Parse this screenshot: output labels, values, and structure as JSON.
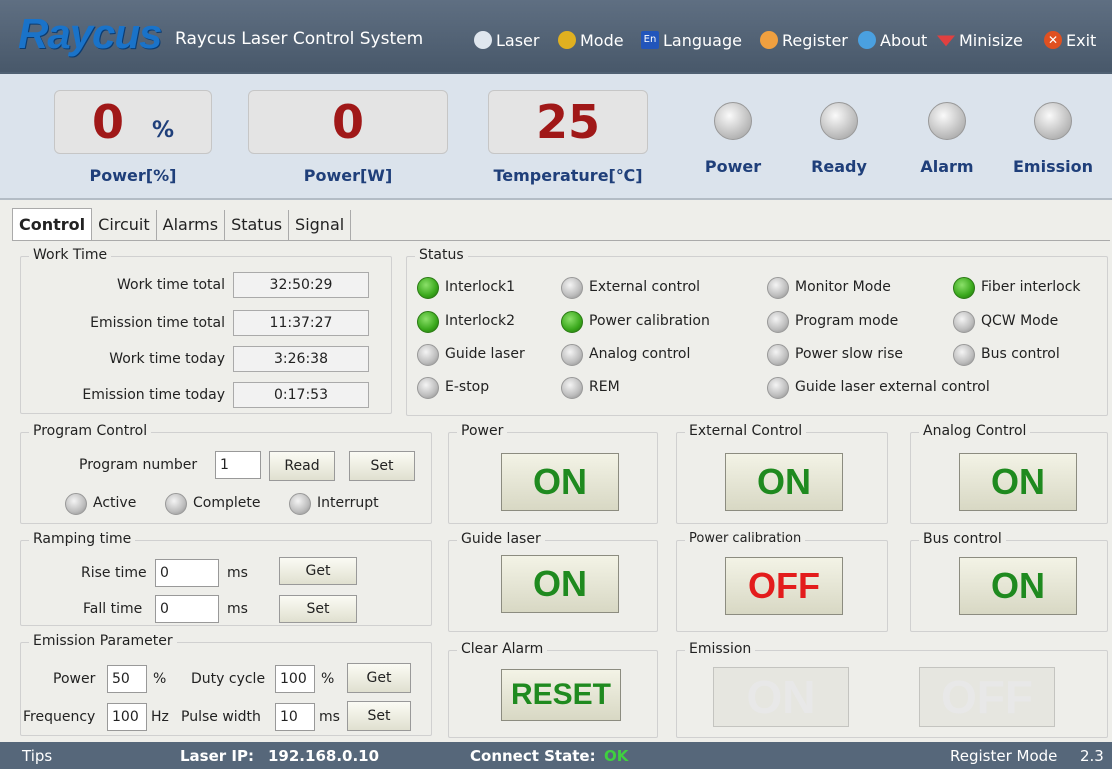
{
  "titlebar": {
    "logo": "Raycus",
    "title": "Raycus Laser Control System",
    "menu": [
      {
        "label": "Laser",
        "icon": "laser-icon",
        "color": "#ffffff"
      },
      {
        "label": "Mode",
        "icon": "people-icon",
        "color": "#e0b020"
      },
      {
        "label": "Language",
        "icon": "en-icon",
        "color": "#2255bb"
      },
      {
        "label": "Register",
        "icon": "pen-icon",
        "color": "#f0a040"
      },
      {
        "label": "About",
        "icon": "globe-icon",
        "color": "#4aa0e0"
      },
      {
        "label": "Minisize",
        "icon": "minimize-icon",
        "color": "#e04040"
      },
      {
        "label": "Exit",
        "icon": "close-icon",
        "color": "#e05020"
      }
    ]
  },
  "readouts": {
    "power_pct": "0",
    "power_pct_unit": "%",
    "power_pct_label": "Power[%]",
    "power_w": "0",
    "power_w_label": "Power[W]",
    "temp": "25",
    "temp_label": "Temperature[℃]"
  },
  "indicators": [
    "Power",
    "Ready",
    "Alarm",
    "Emission"
  ],
  "tabs": [
    "Control",
    "Circuit",
    "Alarms",
    "Status",
    "Signal"
  ],
  "work_time": {
    "title": "Work Time",
    "rows": [
      {
        "label": "Work time total",
        "value": "32:50:29"
      },
      {
        "label": "Emission time total",
        "value": "11:37:27"
      },
      {
        "label": "Work time today",
        "value": "3:26:38"
      },
      {
        "label": "Emission time today",
        "value": "0:17:53"
      }
    ]
  },
  "status": {
    "title": "Status",
    "items": [
      {
        "label": "Interlock1",
        "on": true
      },
      {
        "label": "External control",
        "on": false
      },
      {
        "label": "Monitor Mode",
        "on": false
      },
      {
        "label": "Fiber interlock",
        "on": true
      },
      {
        "label": "Interlock2",
        "on": true
      },
      {
        "label": "Power calibration",
        "on": true
      },
      {
        "label": "Program mode",
        "on": false
      },
      {
        "label": "QCW Mode",
        "on": false
      },
      {
        "label": "Guide laser",
        "on": false
      },
      {
        "label": "Analog control",
        "on": false
      },
      {
        "label": "Power slow rise",
        "on": false
      },
      {
        "label": "Bus control",
        "on": false
      },
      {
        "label": "E-stop",
        "on": false
      },
      {
        "label": "REM",
        "on": false
      },
      {
        "label": "Guide laser external control",
        "on": false
      }
    ]
  },
  "program": {
    "title": "Program Control",
    "number_label": "Program number",
    "number": "1",
    "read": "Read",
    "set": "Set",
    "active": "Active",
    "complete": "Complete",
    "interrupt": "Interrupt"
  },
  "ramping": {
    "title": "Ramping time",
    "rise_label": "Rise time",
    "rise": "0",
    "fall_label": "Fall time",
    "fall": "0",
    "unit": "ms",
    "get": "Get",
    "set": "Set"
  },
  "emission_param": {
    "title": "Emission Parameter",
    "power_label": "Power",
    "power": "50",
    "pct": "%",
    "duty_label": "Duty cycle",
    "duty": "100",
    "duty_unit": "%",
    "get": "Get",
    "freq_label": "Frequency",
    "freq": "100",
    "hz": "Hz",
    "pulse_label": "Pulse width",
    "pulse": "10",
    "ms": "ms",
    "set": "Set"
  },
  "switches": {
    "power": {
      "title": "Power",
      "state": "ON"
    },
    "external": {
      "title": "External Control",
      "state": "ON"
    },
    "analog": {
      "title": "Analog Control",
      "state": "ON"
    },
    "guide": {
      "title": "Guide laser",
      "state": "ON"
    },
    "calib": {
      "title": "Power  calibration",
      "state": "OFF"
    },
    "bus": {
      "title": "Bus control",
      "state": "ON"
    },
    "clear": {
      "title": "Clear Alarm",
      "state": "RESET"
    },
    "emission": {
      "title": "Emission",
      "on": "ON",
      "off": "OFF"
    }
  },
  "statusbar": {
    "tips": "Tips",
    "ip_label": "Laser IP:",
    "ip": "192.168.0.10",
    "conn_label": "Connect State:",
    "conn": "OK",
    "mode": "Register Mode",
    "version": "2.3"
  }
}
